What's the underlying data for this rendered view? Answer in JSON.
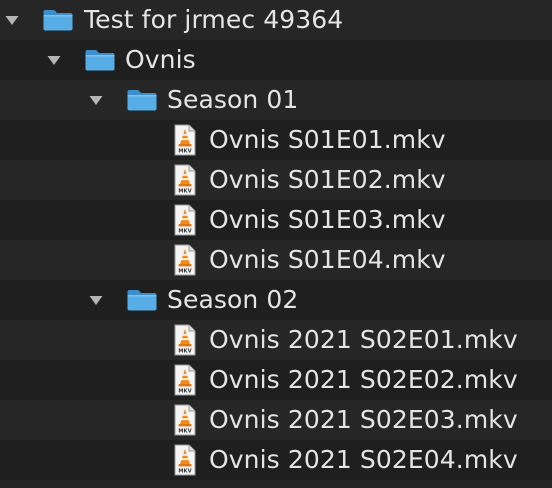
{
  "colors": {
    "background": "#1f1f1f",
    "stripe": "#262626",
    "text": "#e4e4e4",
    "folder": "#4fa7e0",
    "cone_orange": "#f28a1a"
  },
  "tree": {
    "root": {
      "label": "Test for jrmec 49364",
      "icon": "folder-icon",
      "expanded": true
    },
    "show": {
      "label": "Ovnis",
      "icon": "folder-icon",
      "expanded": true
    },
    "season1": {
      "label": "Season 01",
      "icon": "folder-icon",
      "expanded": true,
      "files": [
        {
          "label": "Ovnis S01E01.mkv",
          "icon": "mkv-file-icon",
          "badge": "MKV"
        },
        {
          "label": "Ovnis S01E02.mkv",
          "icon": "mkv-file-icon",
          "badge": "MKV"
        },
        {
          "label": "Ovnis S01E03.mkv",
          "icon": "mkv-file-icon",
          "badge": "MKV"
        },
        {
          "label": "Ovnis S01E04.mkv",
          "icon": "mkv-file-icon",
          "badge": "MKV"
        }
      ]
    },
    "season2": {
      "label": "Season 02",
      "icon": "folder-icon",
      "expanded": true,
      "files": [
        {
          "label": "Ovnis 2021 S02E01.mkv",
          "icon": "mkv-file-icon",
          "badge": "MKV"
        },
        {
          "label": "Ovnis 2021 S02E02.mkv",
          "icon": "mkv-file-icon",
          "badge": "MKV"
        },
        {
          "label": "Ovnis 2021 S02E03.mkv",
          "icon": "mkv-file-icon",
          "badge": "MKV"
        },
        {
          "label": "Ovnis 2021 S02E04.mkv",
          "icon": "mkv-file-icon",
          "badge": "MKV"
        }
      ]
    }
  }
}
